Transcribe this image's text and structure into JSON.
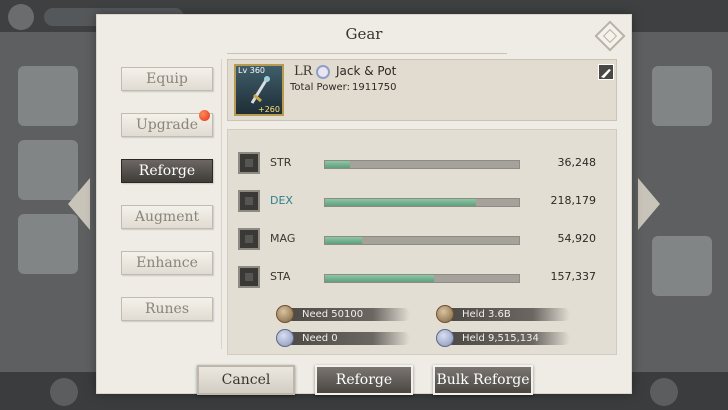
{
  "panel": {
    "title": "Gear"
  },
  "tabs": [
    {
      "label": "Equip",
      "active": false
    },
    {
      "label": "Upgrade",
      "active": false,
      "notification": true
    },
    {
      "label": "Reforge",
      "active": true
    },
    {
      "label": "Augment",
      "active": false
    },
    {
      "label": "Enhance",
      "active": false
    },
    {
      "label": "Runes",
      "active": false
    }
  ],
  "gear": {
    "level": "Lv 360",
    "plus": "+260",
    "rarity": "LR",
    "name": "Jack & Pot",
    "power_label": "Total Power:",
    "power_value": "1911750",
    "icon": "sword-icon",
    "type_icon": "gun-icon"
  },
  "stats": [
    {
      "name": "STR",
      "value": "36,248",
      "fill": 0.13,
      "highlight": false
    },
    {
      "name": "DEX",
      "value": "218,179",
      "fill": 0.78,
      "highlight": true
    },
    {
      "name": "MAG",
      "value": "54,920",
      "fill": 0.19,
      "highlight": false
    },
    {
      "name": "STA",
      "value": "157,337",
      "fill": 0.56,
      "highlight": false
    }
  ],
  "costs": {
    "need_gold": "Need 50100",
    "held_gold": "Held 3.6B",
    "need_stone": "Need 0",
    "held_stone": "Held 9,515,134"
  },
  "actions": {
    "cancel": "Cancel",
    "reforge": "Reforge",
    "bulk_reforge": "Bulk Reforge"
  },
  "colors": {
    "accent_teal": "#2f7f8a",
    "bar_fill": "#5e9f7c",
    "active_tab": "#3f3b37",
    "notification": "#e0321a"
  }
}
